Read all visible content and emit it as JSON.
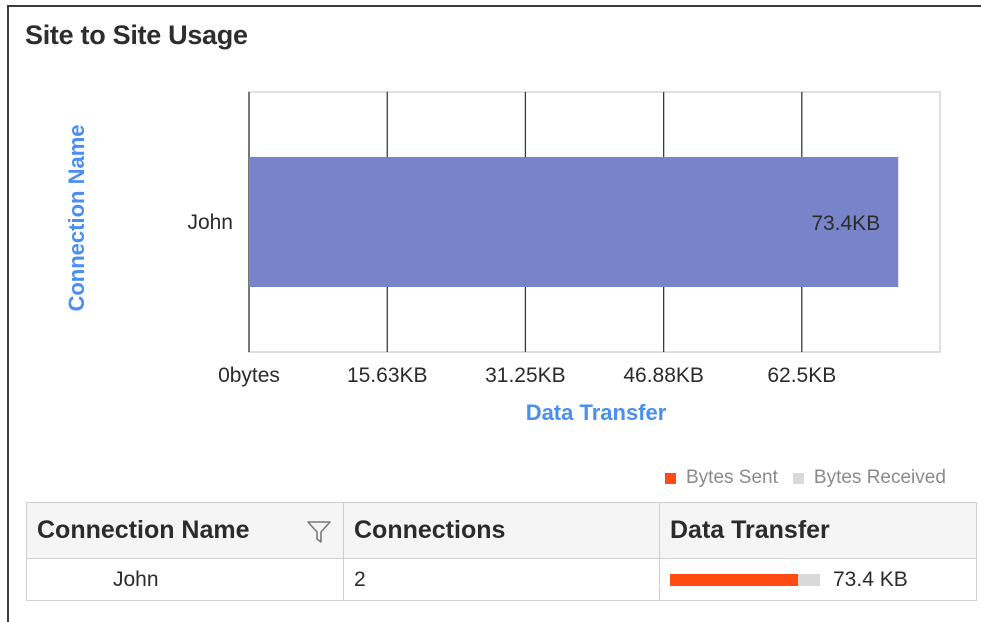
{
  "panel": {
    "title": "Site to Site Usage"
  },
  "chart_data": {
    "type": "bar",
    "orientation": "horizontal",
    "categories": [
      "John"
    ],
    "values": [
      73.4
    ],
    "value_unit": "KB",
    "data_labels": [
      "73.4KB"
    ],
    "xlabel": "Data Transfer",
    "ylabel": "Connection Name",
    "xlim": [
      0,
      78.125
    ],
    "x_ticks": [
      0,
      15.63,
      31.25,
      46.88,
      62.5
    ],
    "x_tick_labels": [
      "0bytes",
      "15.63KB",
      "31.25KB",
      "46.88KB",
      "62.5KB"
    ],
    "grid": true,
    "colors": {
      "bar": "#7884c9",
      "axis_label": "#4a8ef0",
      "grid": "#3a3a3a"
    }
  },
  "legend": {
    "items": [
      {
        "label": "Bytes Sent",
        "color": "#ff4a12"
      },
      {
        "label": "Bytes Received",
        "color": "#d9d9d9"
      }
    ]
  },
  "table": {
    "headers": {
      "name": "Connection Name",
      "connections": "Connections",
      "data_transfer": "Data Transfer"
    },
    "filter_icon": "filter-icon",
    "rows": [
      {
        "name": "John",
        "connections": "2",
        "data_transfer": "73.4 KB",
        "sent_fraction": 0.85
      }
    ]
  }
}
